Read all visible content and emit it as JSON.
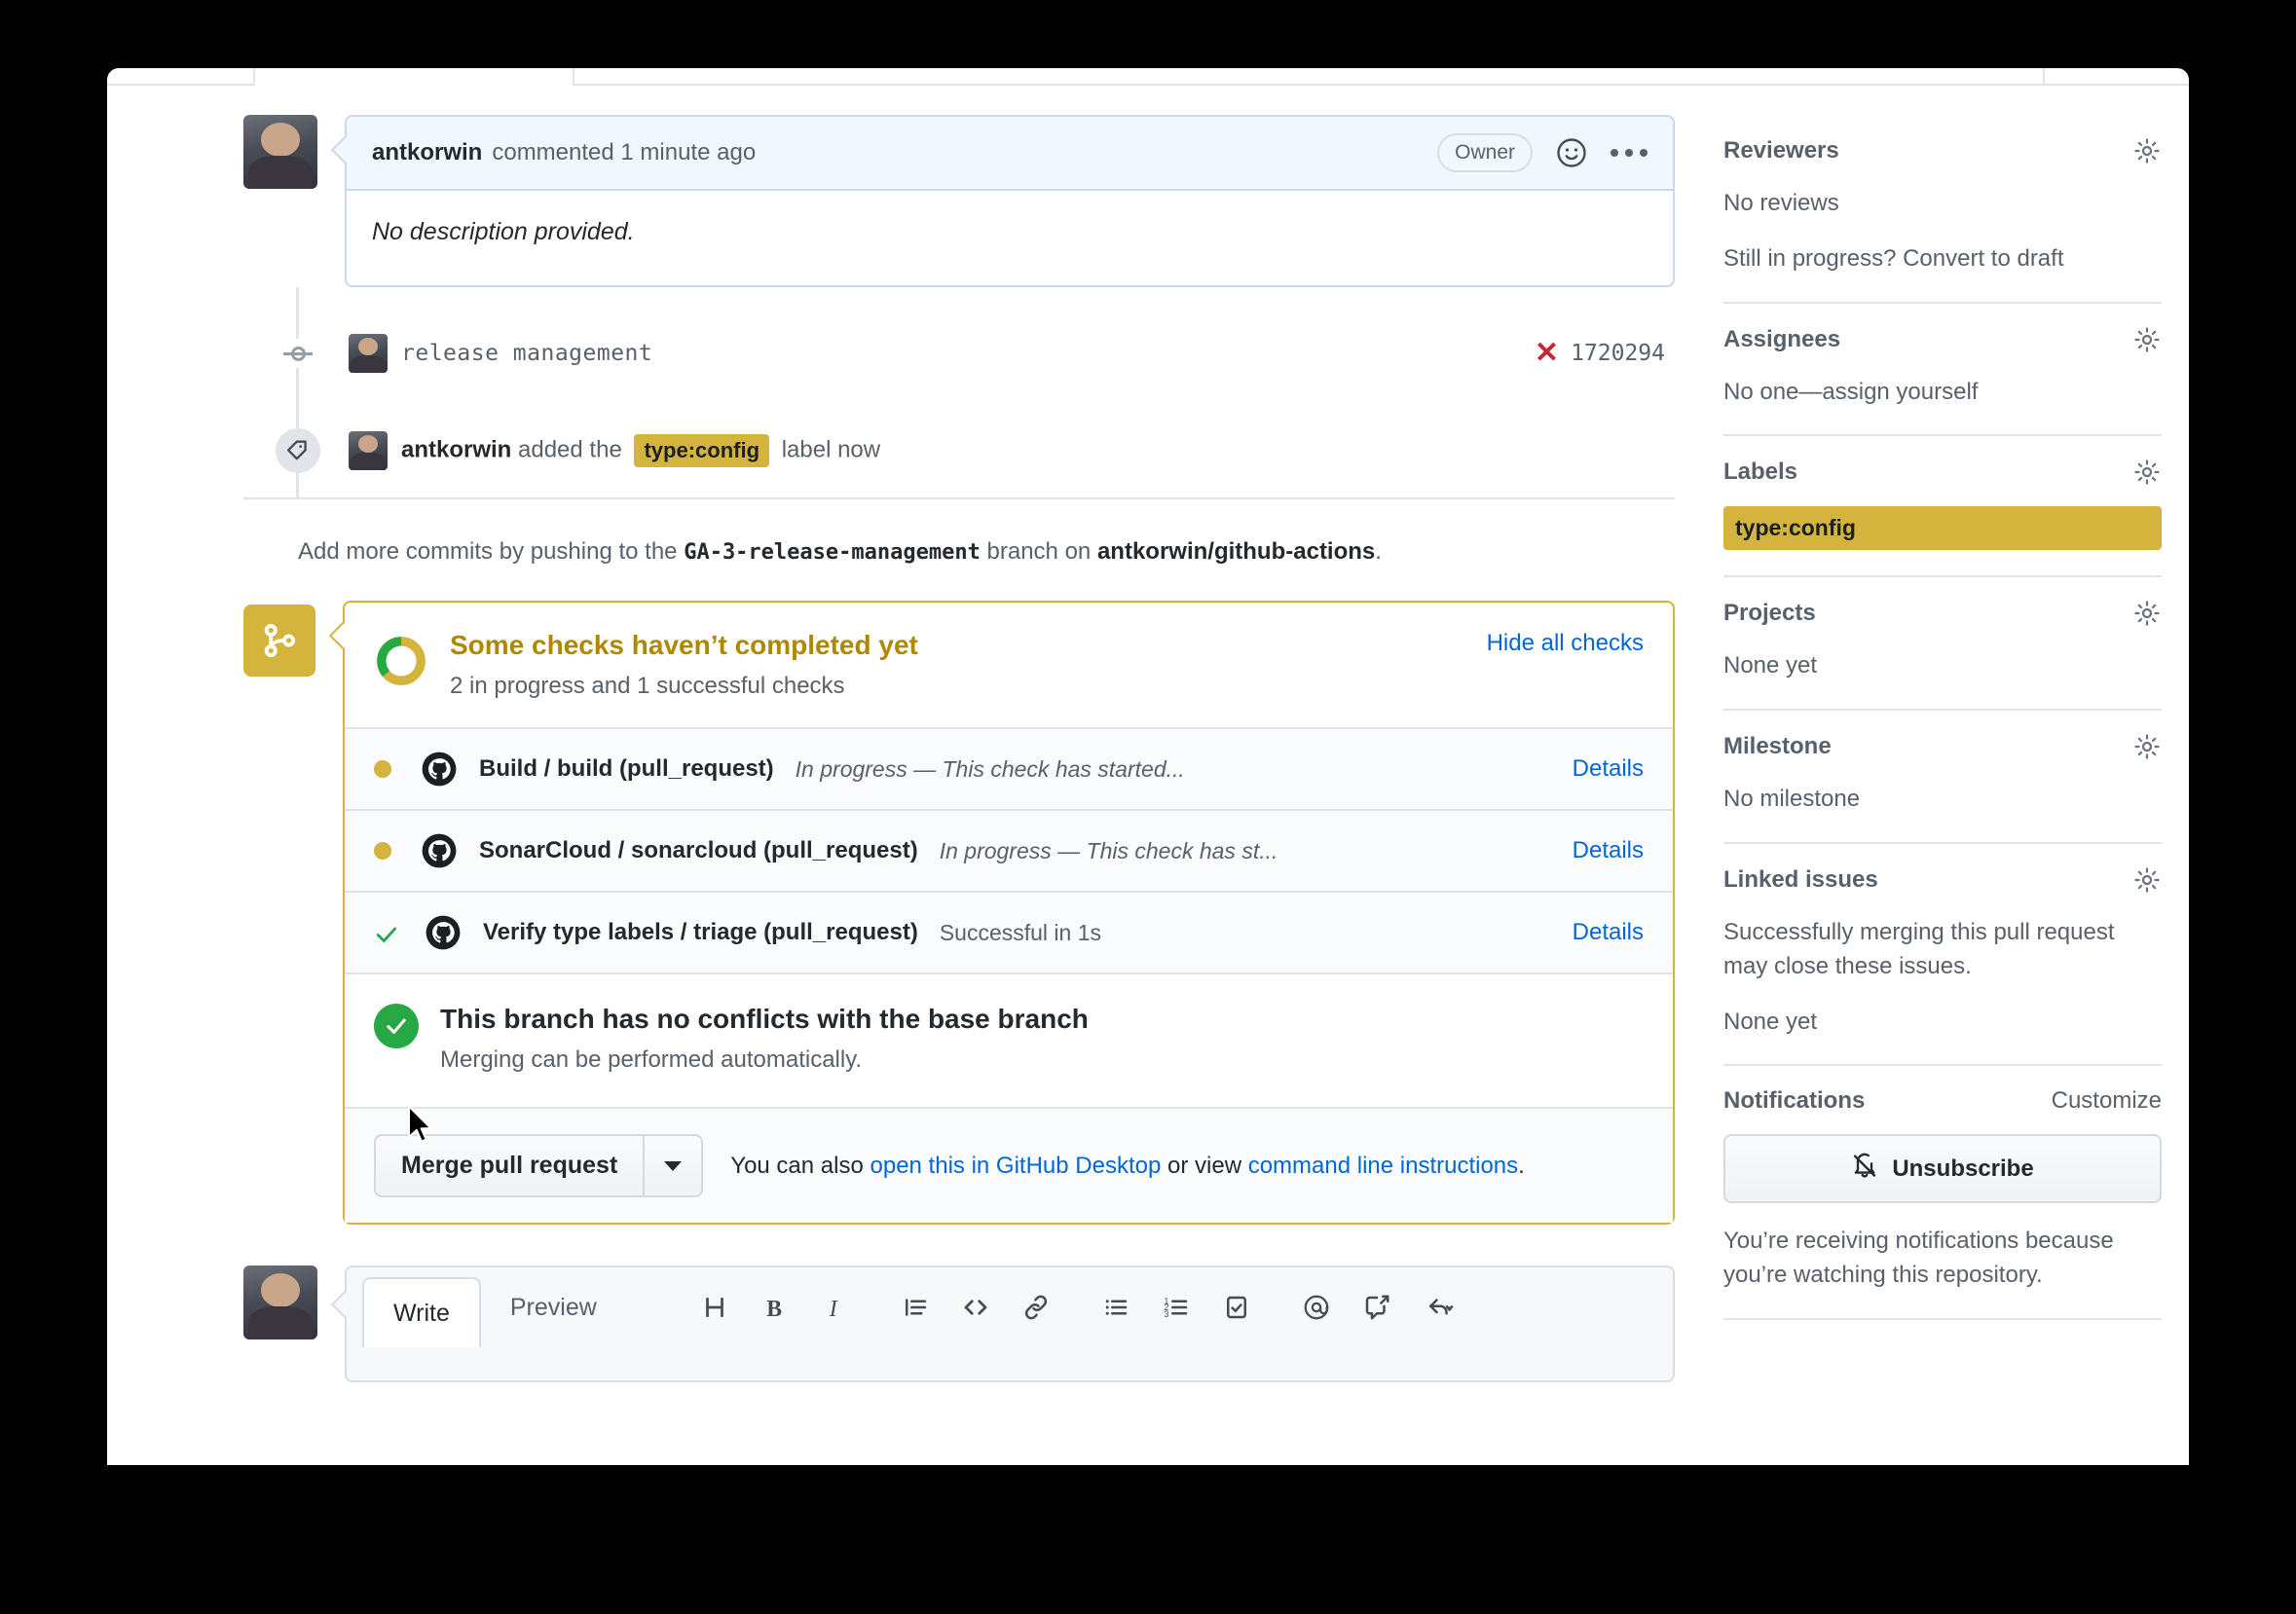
{
  "comment": {
    "author": "antkorwin",
    "meta": "commented 1 minute ago",
    "owner_badge": "Owner",
    "body": "No description provided."
  },
  "timeline": {
    "commit": {
      "message": "release management",
      "sha": "1720294"
    },
    "label_event": {
      "actor": "antkorwin",
      "action": "added the",
      "label": "type:config",
      "suffix": "label now"
    }
  },
  "add_commits": {
    "prefix": "Add more commits by pushing to the",
    "branch": "GA-3-release-management",
    "middle": "branch on",
    "repo": "antkorwin/github-actions",
    "period": "."
  },
  "checks": {
    "title": "Some checks haven’t completed yet",
    "subtitle": "2 in progress and 1 successful checks",
    "hide_all": "Hide all checks",
    "rows": [
      {
        "status": "in_progress",
        "name": "Build / build (pull_request)",
        "status_text": "In progress — This check has started...",
        "details": "Details"
      },
      {
        "status": "in_progress",
        "name": "SonarCloud / sonarcloud (pull_request)",
        "status_text": "In progress — This check has st...",
        "details": "Details"
      },
      {
        "status": "success",
        "name": "Verify type labels / triage (pull_request)",
        "status_text": "Successful in 1s",
        "details": "Details"
      }
    ]
  },
  "conflicts": {
    "title": "This branch has no conflicts with the base branch",
    "subtitle": "Merging can be performed automatically."
  },
  "merge": {
    "button": "Merge pull request",
    "note_prefix": "You can also",
    "desktop_link": "open this in GitHub Desktop",
    "note_middle": "or view",
    "cli_link": "command line instructions",
    "note_suffix": "."
  },
  "editor": {
    "write_tab": "Write",
    "preview_tab": "Preview",
    "toolbar": [
      "heading-icon",
      "bold-icon",
      "italic-icon",
      "quote-icon",
      "code-icon",
      "link-icon",
      "unordered-list-icon",
      "ordered-list-icon",
      "task-list-icon",
      "mention-icon",
      "saved-reply-icon",
      "reply-icon"
    ]
  },
  "sidebar": {
    "reviewers": {
      "title": "Reviewers",
      "text": "No reviews",
      "convert": "Still in progress? Convert to draft"
    },
    "assignees": {
      "title": "Assignees",
      "text": "No one—assign yourself"
    },
    "labels": {
      "title": "Labels",
      "chip": "type:config"
    },
    "projects": {
      "title": "Projects",
      "text": "None yet"
    },
    "milestone": {
      "title": "Milestone",
      "text": "No milestone"
    },
    "linked_issues": {
      "title": "Linked issues",
      "text": "Successfully merging this pull request may close these issues.",
      "none": "None yet"
    },
    "notifications": {
      "title": "Notifications",
      "customize": "Customize",
      "button": "Unsubscribe",
      "text": "You’re receiving notifications because you’re watching this repository."
    }
  },
  "colors": {
    "yellow": "#d4b43c",
    "green": "#28a745",
    "red": "#cb2431",
    "blue": "#0366d6",
    "title_yellow": "#b08800"
  }
}
